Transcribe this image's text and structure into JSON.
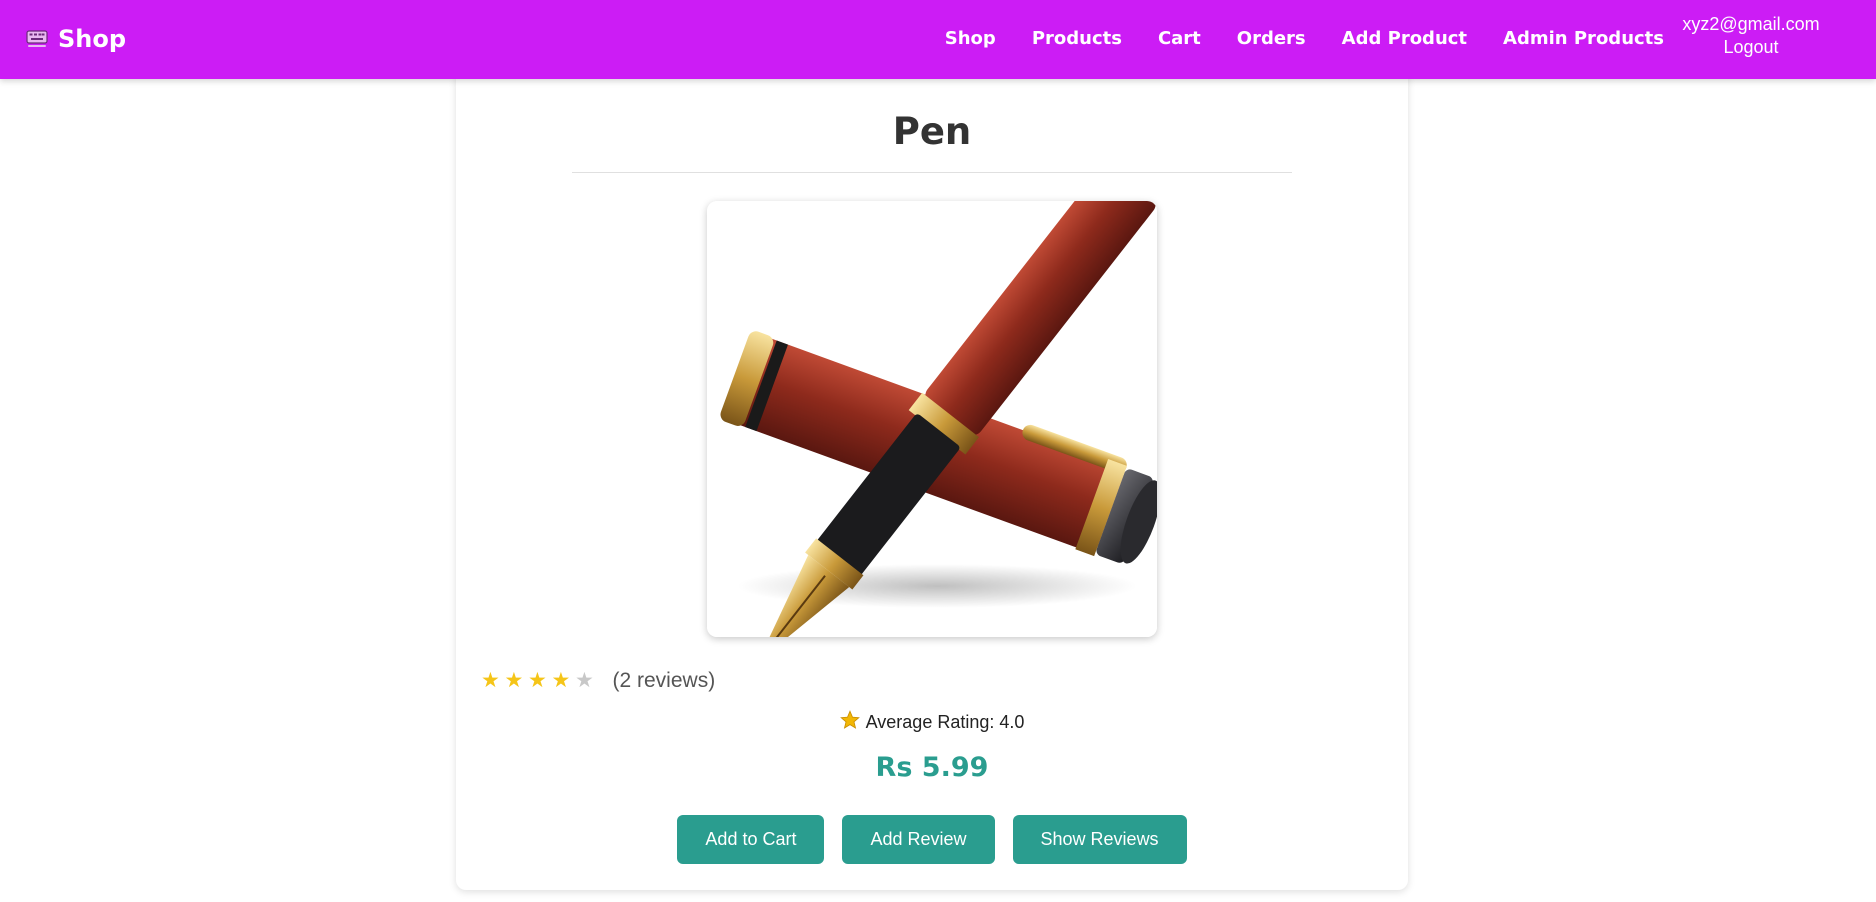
{
  "navbar": {
    "brand": "Shop",
    "brand_icon": "keyboard-icon",
    "links": [
      "Shop",
      "Products",
      "Cart",
      "Orders",
      "Add Product",
      "Admin Products"
    ],
    "user_email": "xyz2@gmail.com",
    "logout": "Logout"
  },
  "product": {
    "title": "Pen",
    "image_subject": "fountain-pen-image",
    "rating_stars": 4,
    "max_stars": 5,
    "review_count": "(2 reviews)",
    "average_rating_label": "Average Rating: 4.0",
    "price": "Rs 5.99"
  },
  "actions": {
    "add_to_cart": "Add to Cart",
    "add_review": "Add Review",
    "show_reviews": "Show Reviews"
  },
  "colors": {
    "navbar": "#cc1cf5",
    "accent": "#2a9d8f",
    "star": "#f5c518"
  }
}
